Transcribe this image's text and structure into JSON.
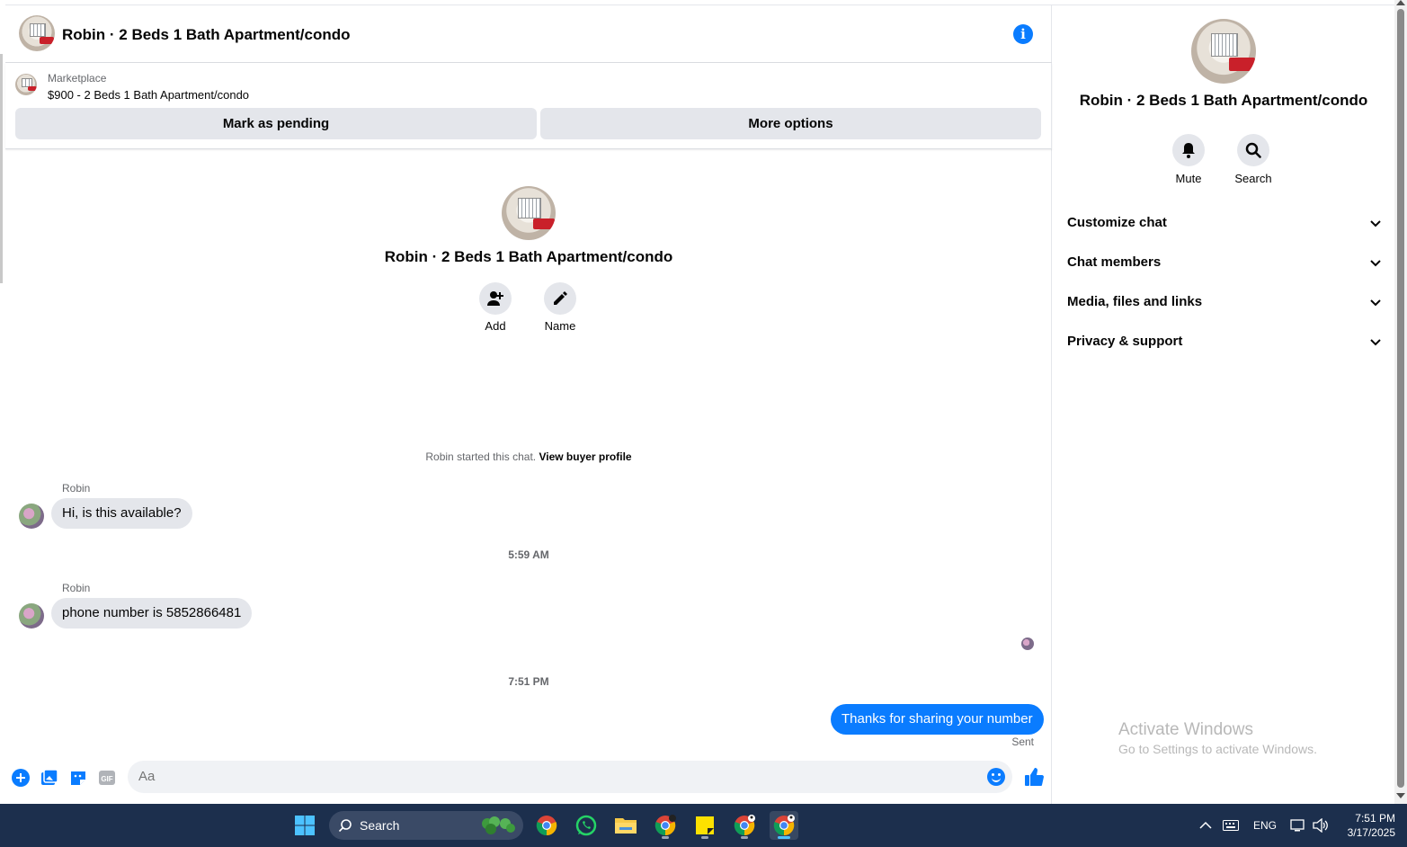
{
  "header": {
    "title": "Robin · 2 Beds 1 Bath Apartment/condo",
    "info_icon": "info-icon"
  },
  "listing": {
    "label": "Marketplace",
    "price_title": "$900 - 2 Beds 1 Bath Apartment/condo",
    "mark_pending_label": "Mark as pending",
    "more_options_label": "More options"
  },
  "profile": {
    "title": "Robin · 2 Beds 1 Bath Apartment/condo",
    "add_label": "Add",
    "name_label": "Name"
  },
  "chat_started": {
    "text": "Robin started this chat.",
    "link": "View buyer profile"
  },
  "messages": [
    {
      "sender": "Robin",
      "text": "Hi, is this available?"
    },
    {
      "timestamp": "5:59 AM"
    },
    {
      "sender": "Robin",
      "text": "phone number is 5852866481"
    },
    {
      "timestamp": "7:51 PM"
    },
    {
      "text": "Thanks for sharing your number",
      "status": "Sent"
    }
  ],
  "composer": {
    "placeholder": "Aa",
    "icons": [
      "plus-icon",
      "image-icon",
      "sticker-icon",
      "gif-icon",
      "emoji-icon",
      "like-icon"
    ],
    "gif_label": "GIF"
  },
  "panel": {
    "title": "Robin · 2 Beds 1 Bath Apartment/condo",
    "mute_label": "Mute",
    "search_label": "Search",
    "sections": [
      "Customize chat",
      "Chat members",
      "Media, files and links",
      "Privacy & support"
    ]
  },
  "watermark": {
    "title": "Activate Windows",
    "subtitle": "Go to Settings to activate Windows."
  },
  "taskbar": {
    "search_label": "Search",
    "lang": "ENG",
    "time": "7:51 PM",
    "date": "3/17/2025"
  },
  "colors": {
    "accent": "#0a7cff",
    "bubble_in": "#e4e6eb",
    "taskbar": "#1c2f4d"
  }
}
